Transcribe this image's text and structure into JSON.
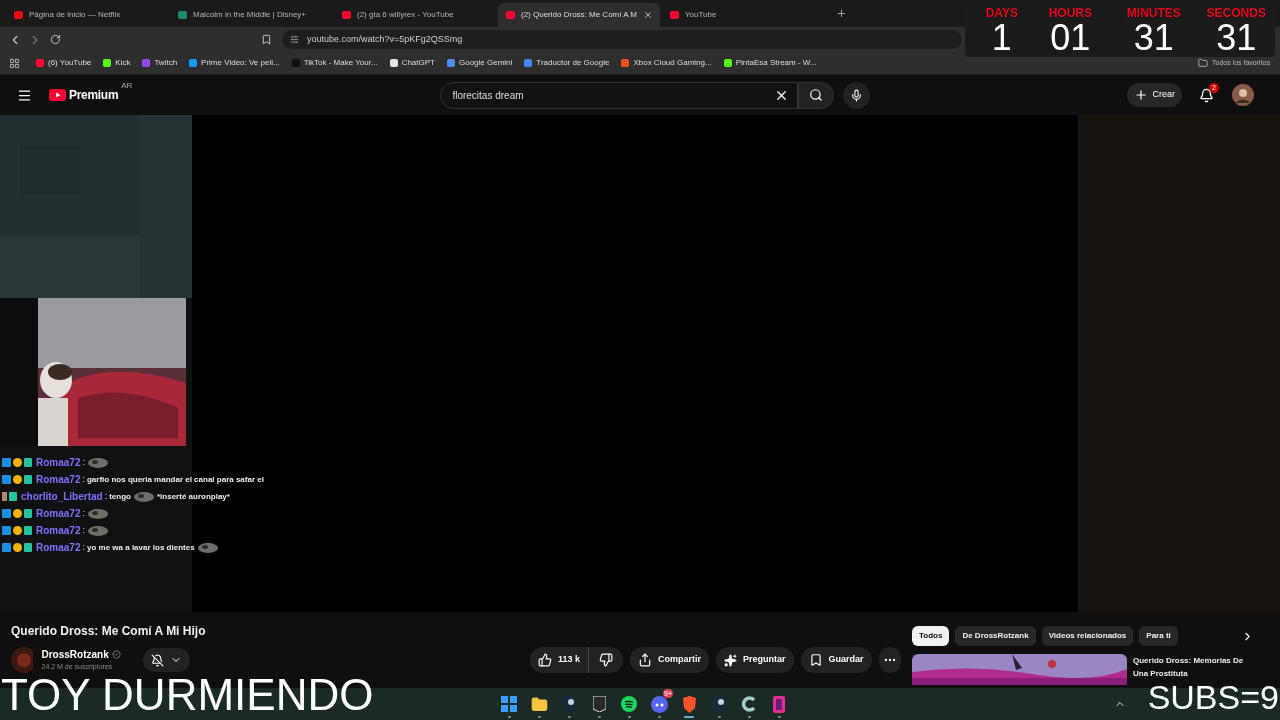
{
  "browser": {
    "tabs": [
      {
        "title": "Página de inicio — Netflix",
        "color": "#e50914",
        "selected": false
      },
      {
        "title": "Malcolm in the Middle | Disney+",
        "color": "#1f8a70",
        "selected": false
      },
      {
        "title": "(2) gta 6 willyrex - YouTube",
        "color": "#ff0033",
        "selected": false
      },
      {
        "title": "(2) Querido Dross: Me Comí A M",
        "color": "#ff0033",
        "selected": true
      },
      {
        "title": "YouTube",
        "color": "#ff0033",
        "selected": false
      }
    ],
    "address": "youtube.com/watch?v=5pKFg2QSSmg",
    "bookmarks": [
      {
        "label": "(6) YouTube",
        "color": "#ff0033"
      },
      {
        "label": "Kick",
        "color": "#53fc18"
      },
      {
        "label": "Twitch",
        "color": "#9146ff"
      },
      {
        "label": "Prime Video: Ve peli...",
        "color": "#1a98ff"
      },
      {
        "label": "TikTok - Make Your...",
        "color": "#111111"
      },
      {
        "label": "ChatGPT",
        "color": "#e5e5e5"
      },
      {
        "label": "Google Gemini",
        "color": "#4f8df5"
      },
      {
        "label": "Traductor de Google",
        "color": "#4285f4"
      },
      {
        "label": "Xbox Cloud Gaming...",
        "color": "#f25022"
      },
      {
        "label": "PintaEsa Stream - W...",
        "color": "#53fc18"
      }
    ],
    "all_bookmarks": "Todos los favoritos"
  },
  "countdown": [
    {
      "label": "DAYS",
      "value": "1"
    },
    {
      "label": "HOURS",
      "value": "01"
    },
    {
      "label": "MINUTES",
      "value": "31"
    },
    {
      "label": "SECONDS",
      "value": "31"
    }
  ],
  "youtube": {
    "logo": "Premium",
    "region": "AR",
    "search": "florecitas dream",
    "create": "Crear",
    "notifications": "2",
    "video": {
      "title": "Querido Dross: Me Comí A Mi Hijo",
      "channel": "DrossRotzank",
      "subscribers": "24.2 M de suscriptores",
      "likes": "113 k",
      "actions": [
        {
          "kind": "share",
          "label": "Compartir"
        },
        {
          "kind": "ask",
          "label": "Preguntar"
        },
        {
          "kind": "save",
          "label": "Guardar"
        }
      ]
    },
    "chips": [
      {
        "label": "Todos",
        "selected": true
      },
      {
        "label": "De DrossRotzank",
        "selected": false
      },
      {
        "label": "Videos relacionados",
        "selected": false
      },
      {
        "label": "Para ti",
        "selected": false
      }
    ],
    "recommended": {
      "title": "Querido Dross: Memorias De Una Prostituta"
    }
  },
  "chat": [
    {
      "user": "Romaa72",
      "separator": ":",
      "color": "#7f72ff",
      "kind": "subscriber",
      "parts": [
        {
          "kind": "emote"
        }
      ]
    },
    {
      "user": "Romaa72",
      "separator": ":",
      "color": "#7f72ff",
      "kind": "subscriber",
      "parts": [
        {
          "kind": "text",
          "text": "garfio nos queria mandar el canal para safar el"
        }
      ]
    },
    {
      "user": "chorlito_Libertad",
      "separator": ":",
      "color": "#7f72ff",
      "kind": "member",
      "parts": [
        {
          "kind": "text",
          "text": "tengo"
        },
        {
          "kind": "emote"
        },
        {
          "kind": "text",
          "text": "*inserté auronplay*"
        }
      ]
    },
    {
      "user": "Romaa72",
      "separator": ":",
      "color": "#7f72ff",
      "kind": "subscriber",
      "parts": [
        {
          "kind": "emote"
        }
      ]
    },
    {
      "user": "Romaa72",
      "separator": ":",
      "color": "#7f72ff",
      "kind": "subscriber",
      "parts": [
        {
          "kind": "emote"
        }
      ]
    },
    {
      "user": "Romaa72",
      "separator": ":",
      "color": "#7f72ff",
      "kind": "subscriber",
      "parts": [
        {
          "kind": "text",
          "text": "yo me wa a lavar los dientes"
        },
        {
          "kind": "emote"
        }
      ]
    }
  ],
  "taskbar": [
    {
      "kind": "windows",
      "active": false
    },
    {
      "kind": "folder",
      "active": false
    },
    {
      "kind": "steam",
      "active": false
    },
    {
      "kind": "epic",
      "active": false
    },
    {
      "kind": "spotify",
      "active": false
    },
    {
      "kind": "discord",
      "active": false,
      "badge": "9+"
    },
    {
      "kind": "brave",
      "active": true
    },
    {
      "kind": "steam",
      "active": false
    },
    {
      "kind": "c-app",
      "active": false
    },
    {
      "kind": "pink-app",
      "active": false
    }
  ],
  "overlays": {
    "caption": "TOY DURMIENDO",
    "subs": "SUBS=9"
  }
}
